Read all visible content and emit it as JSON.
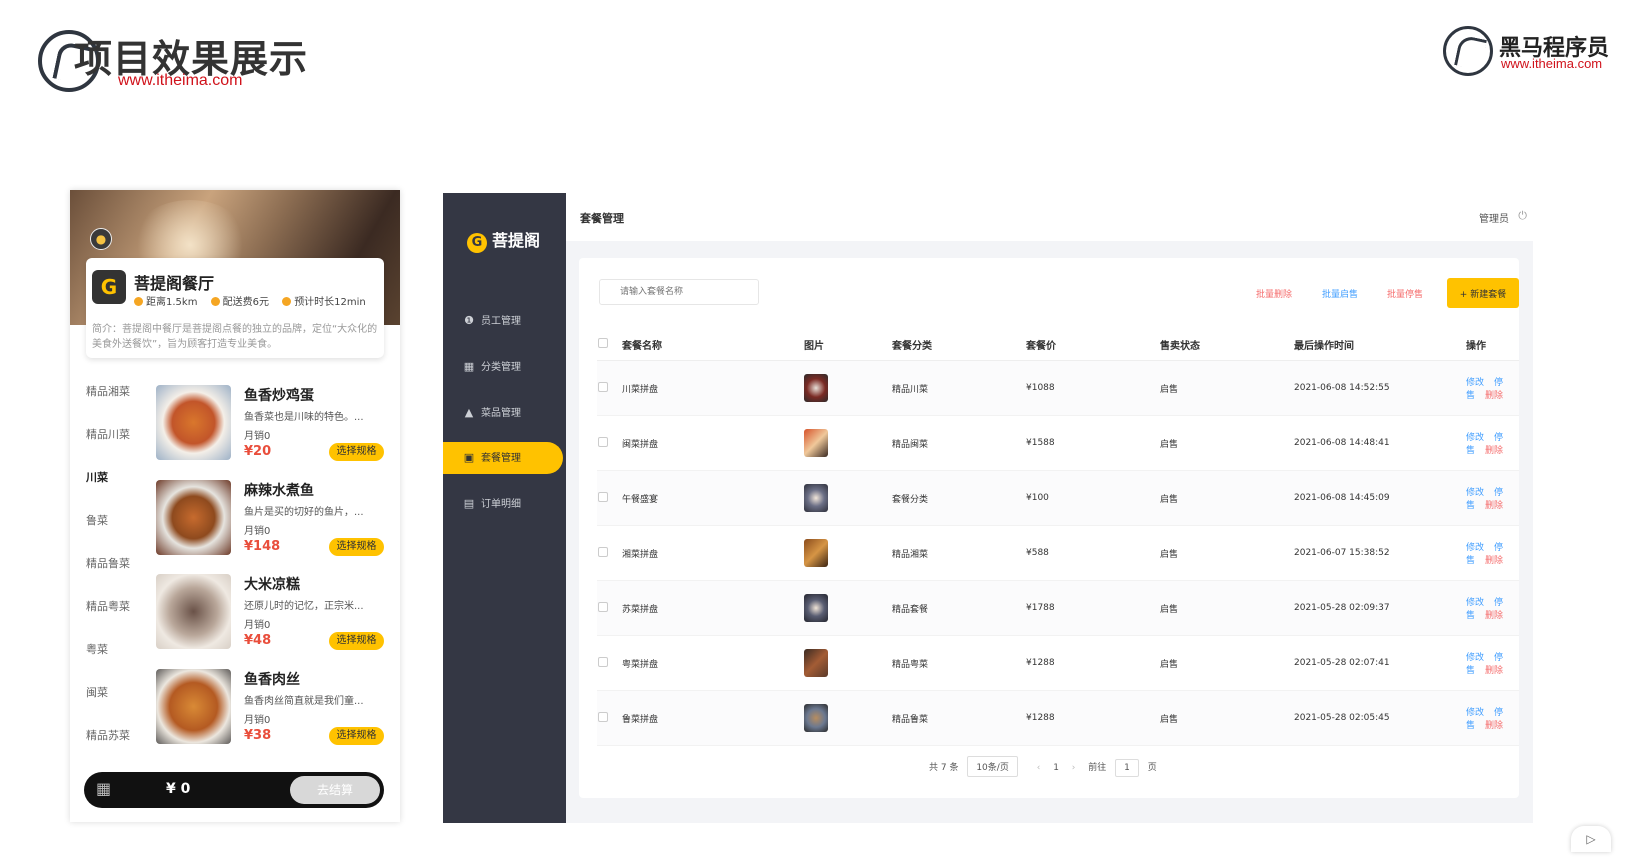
{
  "slide": {
    "title": "项目效果展示",
    "url": "www.itheima.com",
    "brand_name": "黑马程序员",
    "brand_url": "www.itheima.com"
  },
  "mobile": {
    "shop": {
      "logo_char": "G",
      "name": "菩提阁餐厅",
      "distance": "距离1.5km",
      "delivery_fee": "配送费6元",
      "eta": "预计时长12min",
      "desc": "简介：菩提阁中餐厅是菩提阁点餐的独立的品牌，定位“大众化的美食外送餐饮”，旨为顾客打造专业美食。"
    },
    "categories": [
      "精品湘菜",
      "精品川菜",
      "川菜",
      "鲁菜",
      "精品鲁菜",
      "精品粤菜",
      "粤菜",
      "闽菜",
      "精品苏菜"
    ],
    "active_category": "川菜",
    "dishes": [
      {
        "name": "鱼香炒鸡蛋",
        "desc": "鱼香菜也是川味的特色。...",
        "sales": "月销0",
        "price": "¥20",
        "button": "选择规格"
      },
      {
        "name": "麻辣水煮鱼",
        "desc": "鱼片是买的切好的鱼片，...",
        "sales": "月销0",
        "price": "¥148",
        "button": "选择规格"
      },
      {
        "name": "大米凉糕",
        "desc": "还原儿时的记忆，正宗米...",
        "sales": "月销0",
        "price": "¥48",
        "button": "选择规格"
      },
      {
        "name": "鱼香肉丝",
        "desc": "鱼香肉丝简直就是我们童...",
        "sales": "月销0",
        "price": "¥38",
        "button": "选择规格"
      }
    ],
    "cart": {
      "total": "¥ 0",
      "checkout": "去结算"
    }
  },
  "admin": {
    "logo": "菩提阁",
    "menu": [
      {
        "label": "员工管理",
        "icon": "info-icon",
        "glyph": "❶"
      },
      {
        "label": "分类管理",
        "icon": "grid-icon",
        "glyph": "▦"
      },
      {
        "label": "菜品管理",
        "icon": "dish-icon",
        "glyph": "▲"
      },
      {
        "label": "套餐管理",
        "icon": "gift-icon",
        "glyph": "▣"
      },
      {
        "label": "订单明细",
        "icon": "clipboard-icon",
        "glyph": "▤"
      }
    ],
    "active_menu": "套餐管理",
    "page_title": "套餐管理",
    "user": "管理员",
    "search_placeholder": "请输入套餐名称",
    "bulk_delete": "批量删除",
    "bulk_enable": "批量启售",
    "bulk_disable": "批量停售",
    "new_button": "+ 新建套餐",
    "columns": [
      "套餐名称",
      "图片",
      "套餐分类",
      "套餐价",
      "售卖状态",
      "最后操作时间",
      "操作"
    ],
    "rows": [
      {
        "name": "川菜拼盘",
        "category": "精品川菜",
        "price": "¥1088",
        "status": "启售",
        "time": "2021-06-08 14:52:55"
      },
      {
        "name": "闽菜拼盘",
        "category": "精品闽菜",
        "price": "¥1588",
        "status": "启售",
        "time": "2021-06-08 14:48:41"
      },
      {
        "name": "午餐盛宴",
        "category": "套餐分类",
        "price": "¥100",
        "status": "启售",
        "time": "2021-06-08 14:45:09"
      },
      {
        "name": "湘菜拼盘",
        "category": "精品湘菜",
        "price": "¥588",
        "status": "启售",
        "time": "2021-06-07 15:38:52"
      },
      {
        "name": "苏菜拼盘",
        "category": "精品套餐",
        "price": "¥1788",
        "status": "启售",
        "time": "2021-05-28 02:09:37"
      },
      {
        "name": "粤菜拼盘",
        "category": "精品粤菜",
        "price": "¥1288",
        "status": "启售",
        "time": "2021-05-28 02:07:41"
      },
      {
        "name": "鲁菜拼盘",
        "category": "精品鲁菜",
        "price": "¥1288",
        "status": "启售",
        "time": "2021-05-28 02:05:45"
      }
    ],
    "ops": {
      "edit": "修改",
      "stop": "停售",
      "del": "删除"
    },
    "pager": {
      "total": "共 7 条",
      "page_size": "10条/页",
      "current": "1",
      "goto": "前往",
      "goto_value": "1",
      "page_unit": "页",
      "prev": "‹",
      "next": "›"
    }
  },
  "colors": {
    "accent": "#ffc200",
    "sidebar": "#343744",
    "link_blue": "#419eff",
    "danger": "#f56c6c",
    "price_red": "#e94e3c",
    "brand_red": "#d0121b"
  }
}
